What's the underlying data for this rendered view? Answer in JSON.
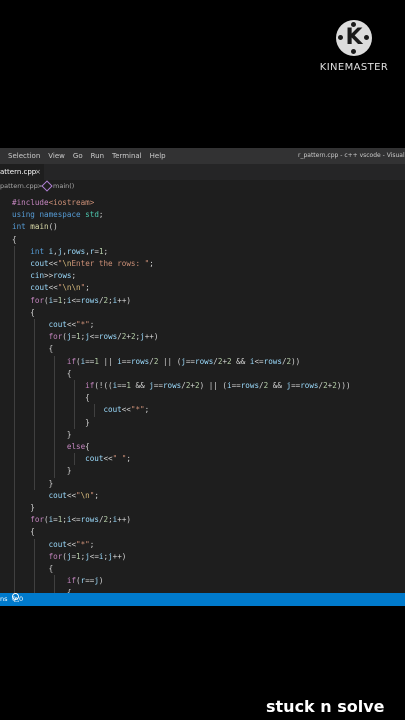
{
  "watermark": {
    "text": "KINEMASTER",
    "logo_letter": "K"
  },
  "menubar": {
    "items": [
      "Selection",
      "View",
      "Go",
      "Run",
      "Terminal",
      "Help"
    ],
    "window_title": "r_pattern.cpp - c++ vscode - Visual S"
  },
  "tab": {
    "label": "attern.cpp",
    "close_glyph": "×"
  },
  "breadcrumb": {
    "file": "pattern.cpp",
    "separator": ">",
    "symbol": "main()"
  },
  "code": [
    [
      [
        "#include",
        "pp"
      ],
      [
        "<iostream>",
        "inc"
      ]
    ],
    [
      [
        "using",
        "kw"
      ],
      [
        " ",
        "ws"
      ],
      [
        "namespace",
        "kw"
      ],
      [
        " ",
        "ws"
      ],
      [
        "std",
        "ty"
      ],
      [
        ";",
        "op"
      ]
    ],
    [
      [
        "int",
        "kw"
      ],
      [
        " ",
        "ws"
      ],
      [
        "main",
        "fn"
      ],
      [
        "()",
        "op"
      ]
    ],
    [
      [
        "{",
        "op"
      ]
    ],
    [
      [
        "    ",
        "ws"
      ],
      [
        "int",
        "kw"
      ],
      [
        " ",
        "ws"
      ],
      [
        "i",
        "var"
      ],
      [
        ",",
        "op"
      ],
      [
        "j",
        "var"
      ],
      [
        ",",
        "op"
      ],
      [
        "rows",
        "var"
      ],
      [
        ",",
        "op"
      ],
      [
        "r",
        "var"
      ],
      [
        "=",
        "op"
      ],
      [
        "1",
        "num"
      ],
      [
        ";",
        "op"
      ]
    ],
    [
      [
        "    ",
        "ws"
      ],
      [
        "cout",
        "var"
      ],
      [
        "<<",
        "op"
      ],
      [
        "\"",
        "str"
      ],
      [
        "\\n",
        "esc"
      ],
      [
        "Enter the rows: \"",
        "str"
      ],
      [
        ";",
        "op"
      ]
    ],
    [
      [
        "    ",
        "ws"
      ],
      [
        "cin",
        "var"
      ],
      [
        ">>",
        "op"
      ],
      [
        "rows",
        "var"
      ],
      [
        ";",
        "op"
      ]
    ],
    [
      [
        "    ",
        "ws"
      ],
      [
        "cout",
        "var"
      ],
      [
        "<<",
        "op"
      ],
      [
        "\"",
        "str"
      ],
      [
        "\\n\\n",
        "esc"
      ],
      [
        "\"",
        "str"
      ],
      [
        ";",
        "op"
      ]
    ],
    [
      [
        "    ",
        "ws"
      ],
      [
        "for",
        "ctl"
      ],
      [
        "(",
        "op"
      ],
      [
        "i",
        "var"
      ],
      [
        "=",
        "op"
      ],
      [
        "1",
        "num"
      ],
      [
        ";",
        "op"
      ],
      [
        "i",
        "var"
      ],
      [
        "<=",
        "op"
      ],
      [
        "rows",
        "var"
      ],
      [
        "/",
        "op"
      ],
      [
        "2",
        "num"
      ],
      [
        ";",
        "op"
      ],
      [
        "i",
        "var"
      ],
      [
        "++)",
        "op"
      ]
    ],
    [
      [
        "    ",
        "ws"
      ],
      [
        "{",
        "op"
      ]
    ],
    [
      [
        "        ",
        "ws"
      ],
      [
        "cout",
        "var"
      ],
      [
        "<<",
        "op"
      ],
      [
        "\"*\"",
        "str"
      ],
      [
        ";",
        "op"
      ]
    ],
    [
      [
        "        ",
        "ws"
      ],
      [
        "for",
        "ctl"
      ],
      [
        "(",
        "op"
      ],
      [
        "j",
        "var"
      ],
      [
        "=",
        "op"
      ],
      [
        "1",
        "num"
      ],
      [
        ";",
        "op"
      ],
      [
        "j",
        "var"
      ],
      [
        "<=",
        "op"
      ],
      [
        "rows",
        "var"
      ],
      [
        "/",
        "op"
      ],
      [
        "2",
        "num"
      ],
      [
        "+",
        "op"
      ],
      [
        "2",
        "num"
      ],
      [
        ";",
        "op"
      ],
      [
        "j",
        "var"
      ],
      [
        "++)",
        "op"
      ]
    ],
    [
      [
        "        ",
        "ws"
      ],
      [
        "{",
        "op"
      ]
    ],
    [
      [
        "            ",
        "ws"
      ],
      [
        "if",
        "ctl"
      ],
      [
        "(",
        "op"
      ],
      [
        "i",
        "var"
      ],
      [
        "==",
        "op"
      ],
      [
        "1",
        "num"
      ],
      [
        " || ",
        "op"
      ],
      [
        "i",
        "var"
      ],
      [
        "==",
        "op"
      ],
      [
        "rows",
        "var"
      ],
      [
        "/",
        "op"
      ],
      [
        "2",
        "num"
      ],
      [
        " || (",
        "op"
      ],
      [
        "j",
        "var"
      ],
      [
        "==",
        "op"
      ],
      [
        "rows",
        "var"
      ],
      [
        "/",
        "op"
      ],
      [
        "2",
        "num"
      ],
      [
        "+",
        "op"
      ],
      [
        "2",
        "num"
      ],
      [
        " && ",
        "op"
      ],
      [
        "i",
        "var"
      ],
      [
        "<=",
        "op"
      ],
      [
        "rows",
        "var"
      ],
      [
        "/",
        "op"
      ],
      [
        "2",
        "num"
      ],
      [
        "))",
        "op"
      ]
    ],
    [
      [
        "            ",
        "ws"
      ],
      [
        "{",
        "op"
      ]
    ],
    [
      [
        "                ",
        "ws"
      ],
      [
        "if",
        "ctl"
      ],
      [
        "(!((",
        "op"
      ],
      [
        "i",
        "var"
      ],
      [
        "==",
        "op"
      ],
      [
        "1",
        "num"
      ],
      [
        " && ",
        "op"
      ],
      [
        "j",
        "var"
      ],
      [
        "==",
        "op"
      ],
      [
        "rows",
        "var"
      ],
      [
        "/",
        "op"
      ],
      [
        "2",
        "num"
      ],
      [
        "+",
        "op"
      ],
      [
        "2",
        "num"
      ],
      [
        ") || (",
        "op"
      ],
      [
        "i",
        "var"
      ],
      [
        "==",
        "op"
      ],
      [
        "rows",
        "var"
      ],
      [
        "/",
        "op"
      ],
      [
        "2",
        "num"
      ],
      [
        " && ",
        "op"
      ],
      [
        "j",
        "var"
      ],
      [
        "==",
        "op"
      ],
      [
        "rows",
        "var"
      ],
      [
        "/",
        "op"
      ],
      [
        "2",
        "num"
      ],
      [
        "+",
        "op"
      ],
      [
        "2",
        "num"
      ],
      [
        ")))",
        "op"
      ]
    ],
    [
      [
        "                ",
        "ws"
      ],
      [
        "{",
        "op"
      ]
    ],
    [
      [
        "                    ",
        "ws"
      ],
      [
        "cout",
        "var"
      ],
      [
        "<<",
        "op"
      ],
      [
        "\"*\"",
        "str"
      ],
      [
        ";",
        "op"
      ]
    ],
    [
      [
        "                ",
        "ws"
      ],
      [
        "}",
        "op"
      ]
    ],
    [
      [
        "            ",
        "ws"
      ],
      [
        "}",
        "op"
      ]
    ],
    [
      [
        "            ",
        "ws"
      ],
      [
        "else",
        "ctl"
      ],
      [
        "{",
        "op"
      ]
    ],
    [
      [
        "                ",
        "ws"
      ],
      [
        "cout",
        "var"
      ],
      [
        "<<",
        "op"
      ],
      [
        "\" \"",
        "str"
      ],
      [
        ";",
        "op"
      ]
    ],
    [
      [
        "            ",
        "ws"
      ],
      [
        "}",
        "op"
      ]
    ],
    [
      [
        "        ",
        "ws"
      ],
      [
        "}",
        "op"
      ]
    ],
    [
      [
        "        ",
        "ws"
      ],
      [
        "cout",
        "var"
      ],
      [
        "<<",
        "op"
      ],
      [
        "\"",
        "str"
      ],
      [
        "\\n",
        "esc"
      ],
      [
        "\"",
        "str"
      ],
      [
        ";",
        "op"
      ]
    ],
    [
      [
        "    ",
        "ws"
      ],
      [
        "}",
        "op"
      ]
    ],
    [
      [
        "    ",
        "ws"
      ],
      [
        "for",
        "ctl"
      ],
      [
        "(",
        "op"
      ],
      [
        "i",
        "var"
      ],
      [
        "=",
        "op"
      ],
      [
        "1",
        "num"
      ],
      [
        ";",
        "op"
      ],
      [
        "i",
        "var"
      ],
      [
        "<=",
        "op"
      ],
      [
        "rows",
        "var"
      ],
      [
        "/",
        "op"
      ],
      [
        "2",
        "num"
      ],
      [
        ";",
        "op"
      ],
      [
        "i",
        "var"
      ],
      [
        "++)",
        "op"
      ]
    ],
    [
      [
        "    ",
        "ws"
      ],
      [
        "{",
        "op"
      ]
    ],
    [
      [
        "        ",
        "ws"
      ],
      [
        "cout",
        "var"
      ],
      [
        "<<",
        "op"
      ],
      [
        "\"*\"",
        "str"
      ],
      [
        ";",
        "op"
      ]
    ],
    [
      [
        "        ",
        "ws"
      ],
      [
        "for",
        "ctl"
      ],
      [
        "(",
        "op"
      ],
      [
        "j",
        "var"
      ],
      [
        "=",
        "op"
      ],
      [
        "1",
        "num"
      ],
      [
        ";",
        "op"
      ],
      [
        "j",
        "var"
      ],
      [
        "<=",
        "op"
      ],
      [
        "i",
        "var"
      ],
      [
        ";",
        "op"
      ],
      [
        "j",
        "var"
      ],
      [
        "++)",
        "op"
      ]
    ],
    [
      [
        "        ",
        "ws"
      ],
      [
        "{",
        "op"
      ]
    ],
    [
      [
        "            ",
        "ws"
      ],
      [
        "if",
        "ctl"
      ],
      [
        "(",
        "op"
      ],
      [
        "r",
        "var"
      ],
      [
        "==",
        "op"
      ],
      [
        "j",
        "var"
      ],
      [
        ")",
        "op"
      ]
    ],
    [
      [
        "            ",
        "ws"
      ],
      [
        "{",
        "op"
      ]
    ]
  ],
  "statusbar": {
    "left_text": "ns",
    "errors": "0",
    "warnings": "0"
  },
  "caption": "stuck n solve",
  "colors": {
    "editor_bg": "#1e1e1e",
    "menubar_bg": "#323233",
    "statusbar_bg": "#007acc",
    "keyword": "#569cd6",
    "control": "#c586c0",
    "string": "#ce9178",
    "number": "#b5cea8",
    "variable": "#9cdcfe",
    "function": "#dcdcaa"
  }
}
